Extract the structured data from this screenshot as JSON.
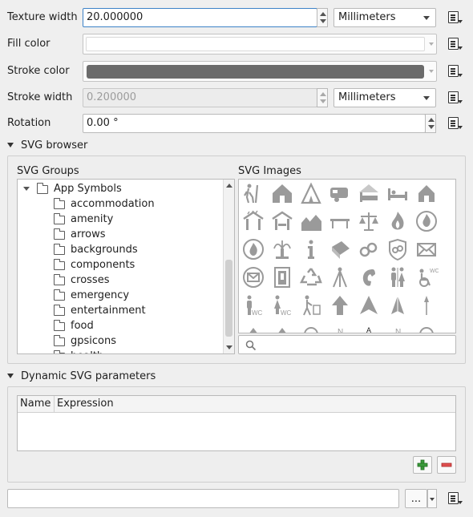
{
  "symbol_props": {
    "texture_width": {
      "label": "Texture width",
      "value": "20.000000",
      "unit": "Millimeters"
    },
    "fill_color": {
      "label": "Fill color"
    },
    "stroke_color": {
      "label": "Stroke color",
      "color": "#6b6b6b"
    },
    "stroke_width": {
      "label": "Stroke width",
      "value": "0.200000",
      "unit": "Millimeters"
    },
    "rotation": {
      "label": "Rotation",
      "value": "0.00 °"
    }
  },
  "svg_browser": {
    "title": "SVG browser",
    "groups_label": "SVG Groups",
    "images_label": "SVG Images",
    "root": "App Symbols",
    "folders": [
      "accommodation",
      "amenity",
      "arrows",
      "backgrounds",
      "components",
      "crosses",
      "emergency",
      "entertainment",
      "food",
      "gpsicons",
      "health"
    ],
    "icons": [
      "hiker-icon",
      "alpine-hut-icon",
      "camping-tent-icon",
      "caravan-icon",
      "hostel-bed-icon",
      "bed-icon",
      "house-icon",
      "shelter-icon",
      "picnic-shelter-icon",
      "chalet-icon",
      "bench-icon",
      "courthouse-icon",
      "fire-icon",
      "fire-station-icon",
      "fire-hydrant-icon",
      "fountain-icon",
      "information-icon",
      "library-icon",
      "handcuffs-icon",
      "police-icon",
      "post-box-icon",
      "postbox-icon",
      "phone-booth-icon",
      "recycling-icon",
      "survey-point-icon",
      "telephone-icon",
      "toilets-icon",
      "wheelchair-wc-icon",
      "men-wc-icon",
      "women-wc-icon",
      "waste-basket-icon",
      "arrow-up-icon",
      "arrow-north-icon",
      "arrow-thin-icon",
      "arrow-line-icon"
    ],
    "search_icon": "search-icon"
  },
  "dynamic": {
    "title": "Dynamic SVG parameters",
    "columns": [
      "Name",
      "Expression"
    ],
    "add_icon": "plus-icon",
    "remove_icon": "minus-icon"
  },
  "footer": {
    "path_value": "",
    "browse_label": "..."
  }
}
